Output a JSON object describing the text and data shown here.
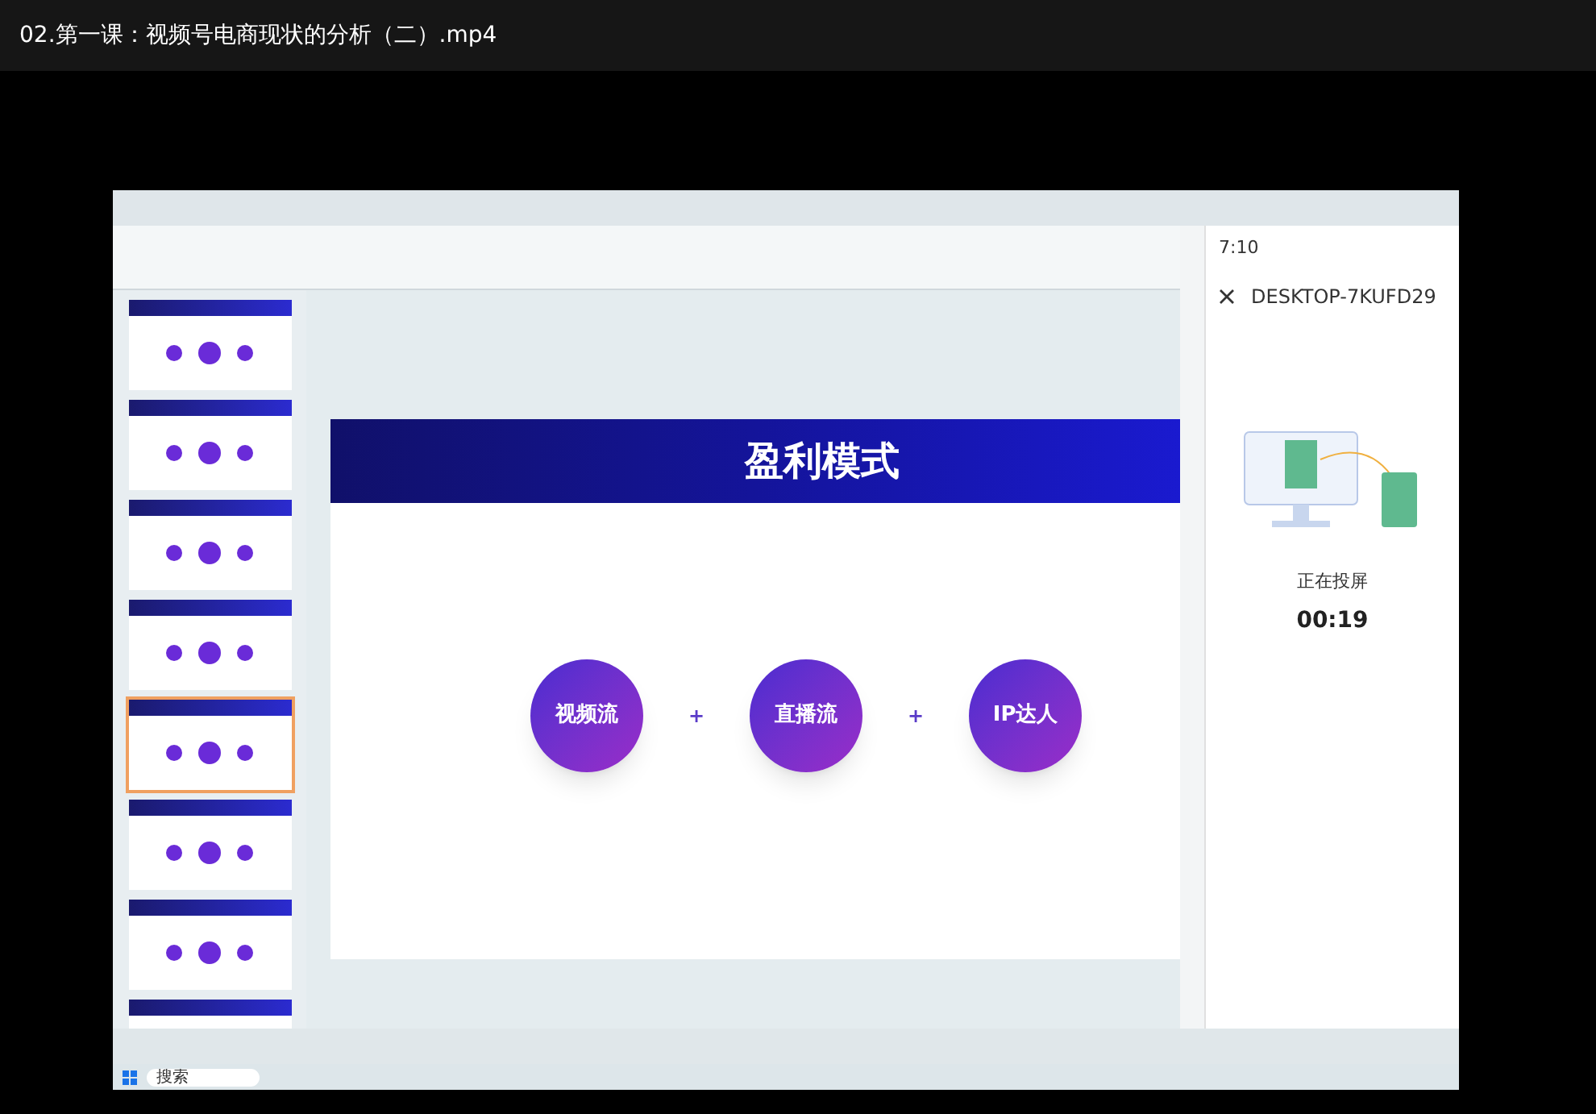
{
  "window": {
    "title": "02.第一课：视频号电商现状的分析（二）.mp4"
  },
  "slide": {
    "title": "盈利模式",
    "items": [
      {
        "label": "视频流"
      },
      {
        "label": "直播流"
      },
      {
        "label": "IP达人"
      }
    ],
    "separators": [
      "+",
      "+"
    ]
  },
  "phone": {
    "time": "7:10",
    "device": "DESKTOP-7KUFD29",
    "status": "正在投屏",
    "timer": "00:19"
  },
  "taskbar": {
    "search_placeholder": "搜索"
  }
}
